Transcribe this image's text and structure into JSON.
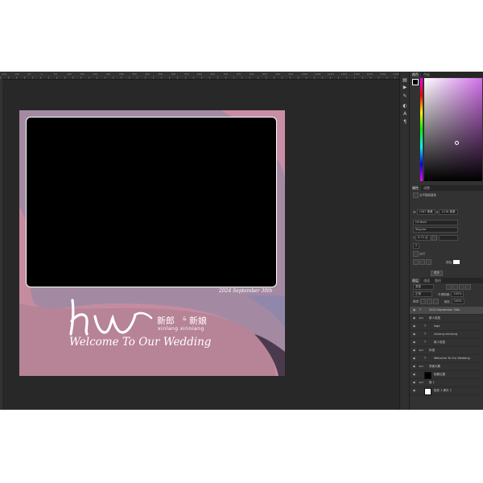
{
  "ruler": {
    "labels": [
      "150",
      "100",
      "50",
      "0",
      "50",
      "100",
      "150",
      "200",
      "250",
      "300",
      "350",
      "400",
      "450",
      "500",
      "550",
      "600",
      "650",
      "700",
      "750",
      "800",
      "850",
      "900",
      "950",
      "1000",
      "1050",
      "1100",
      "1150",
      "1200",
      "1250",
      "1300",
      "1350"
    ]
  },
  "design": {
    "date": "2024 September 30th",
    "logo_letters": "hw",
    "groom": "新郎",
    "amp": "&",
    "bride": "新娘",
    "pinyin": "xinlang  xinniang",
    "welcome": "Welcome To Our Wedding",
    "colors": {
      "background": "#a08aa3",
      "wave": "#c38a9d",
      "dark_wave": "#4b3a4e",
      "photo": "#000000"
    }
  },
  "panel": {
    "color_tabs": [
      "颜色",
      "色板"
    ],
    "props_tabs": [
      "属性",
      "调整"
    ],
    "props_title": "文字图层属性",
    "props_fields": {
      "w": "1287 像素",
      "h": "2218 像素"
    },
    "font": "HS Bold",
    "style": "Regular",
    "size": "6.72 点",
    "tracking": "0",
    "color_label": "颜色:",
    "toggle": "分行",
    "more_button": "更多",
    "layer_tabs": [
      "图层",
      "通道",
      "路径"
    ],
    "layer_filter": "类型",
    "blend_mode": "正常",
    "opacity_label": "不透明度:",
    "opacity": "100%",
    "lock_label": "锁定:",
    "fill_label": "填充:",
    "fill": "100%",
    "layers": [
      {
        "name": "2024 September 30th",
        "type": "text",
        "indent": 0,
        "selected": true
      },
      {
        "name": "新人信息",
        "type": "group",
        "indent": 0,
        "selected": false
      },
      {
        "name": "logo",
        "type": "text",
        "indent": 1,
        "selected": false
      },
      {
        "name": "xinlang  xinniang",
        "type": "text",
        "indent": 1,
        "selected": false
      },
      {
        "name": "新人信息",
        "type": "text",
        "indent": 1,
        "selected": false
      },
      {
        "name": "标语",
        "type": "group",
        "indent": 0,
        "selected": false
      },
      {
        "name": "Welcome To Our Wedding",
        "type": "text",
        "indent": 1,
        "selected": false
      },
      {
        "name": "背景元素",
        "type": "group",
        "indent": 0,
        "selected": false
      },
      {
        "name": "相框位置",
        "type": "thumb-black",
        "indent": 1,
        "selected": false
      },
      {
        "name": "组 1",
        "type": "group",
        "indent": 0,
        "selected": false
      },
      {
        "name": "矩形 1 拷贝 2",
        "type": "thumb-white",
        "indent": 1,
        "selected": false
      }
    ]
  }
}
